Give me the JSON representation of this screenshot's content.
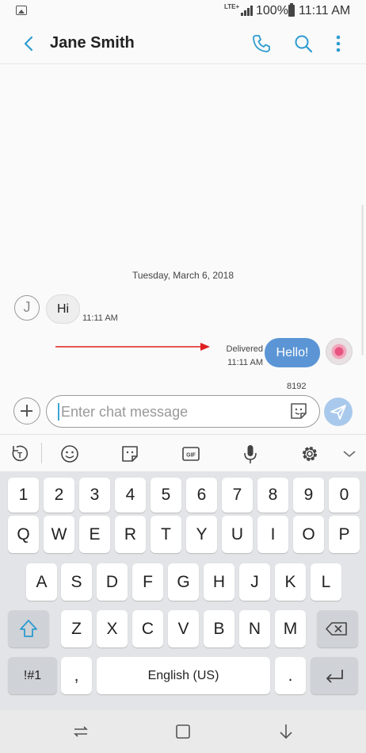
{
  "status_bar": {
    "network": "LTE+",
    "battery": "100%",
    "time": "11:11 AM"
  },
  "header": {
    "title": "Jane Smith",
    "icons": [
      "back-arrow-icon",
      "phone-icon",
      "search-icon",
      "more-vert-icon"
    ]
  },
  "conversation": {
    "date_separator": "Tuesday, March 6, 2018",
    "messages": [
      {
        "direction": "incoming",
        "avatar_initial": "J",
        "text": "Hi",
        "time": "11:11 AM"
      },
      {
        "direction": "outgoing",
        "text": "Hello!",
        "status": "Delivered",
        "time": "11:11 AM"
      }
    ]
  },
  "composer": {
    "char_count": "8192",
    "placeholder": "Enter chat message"
  },
  "keyboard": {
    "toolbar_icons": [
      "text-mode-icon",
      "emoji-icon",
      "sticker-icon",
      "gif-icon",
      "microphone-icon",
      "settings-icon",
      "chevron-down-icon"
    ],
    "row_numbers": [
      "1",
      "2",
      "3",
      "4",
      "5",
      "6",
      "7",
      "8",
      "9",
      "0"
    ],
    "row1": [
      "Q",
      "W",
      "E",
      "R",
      "T",
      "Y",
      "U",
      "I",
      "O",
      "P"
    ],
    "row2": [
      "A",
      "S",
      "D",
      "F",
      "G",
      "H",
      "J",
      "K",
      "L"
    ],
    "row3": [
      "Z",
      "X",
      "C",
      "V",
      "B",
      "N",
      "M"
    ],
    "symbols_label": "!#1",
    "comma_label": ",",
    "space_label": "English (US)",
    "period_label": "."
  },
  "nav_bar": {
    "icons": [
      "recents-icon",
      "home-icon",
      "back-icon"
    ]
  },
  "colors": {
    "accent": "#2e9bd0",
    "outgoing_bubble": "#5b95d5",
    "incoming_bubble": "#eeeeee",
    "annotation_arrow": "#e02020"
  }
}
